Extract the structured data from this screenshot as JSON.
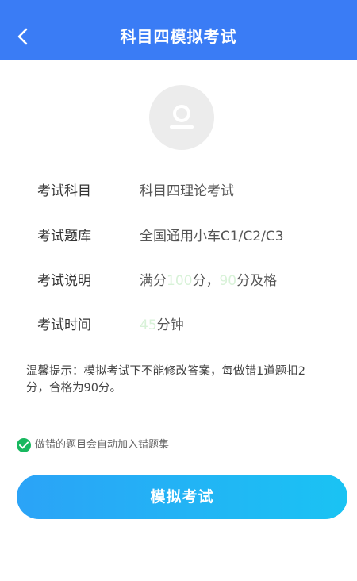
{
  "header": {
    "title": "科目四模拟考试"
  },
  "info": {
    "subject": {
      "label": "考试科目",
      "value": "科目四理论考试"
    },
    "bank": {
      "label": "考试题库",
      "value": "全国通用小车C1/C2/C3"
    },
    "desc": {
      "label": "考试说明",
      "prefix": "满分",
      "full_score": "100",
      "mid": "分，",
      "pass_score": "90",
      "suffix": "分及格"
    },
    "time": {
      "label": "考试时间",
      "minutes": "45",
      "unit": "分钟"
    }
  },
  "tip": {
    "text": "温馨提示：模拟考试下不能修改答案，每做错1道题扣2分，合格为90分。"
  },
  "auto_add": {
    "label": "做错的题目会自动加入错题集",
    "checked": true
  },
  "start_button": {
    "label": "模拟考试"
  },
  "colors": {
    "primary": "#3a7cf5",
    "button_gradient_start": "#2ba3f7",
    "button_gradient_end": "#1ac3f3",
    "check": "#18b85f",
    "highlight": "#d8f2d8"
  },
  "icons": {
    "back": "chevron-left-icon",
    "avatar": "user-avatar-icon",
    "check": "check-circle-icon"
  }
}
